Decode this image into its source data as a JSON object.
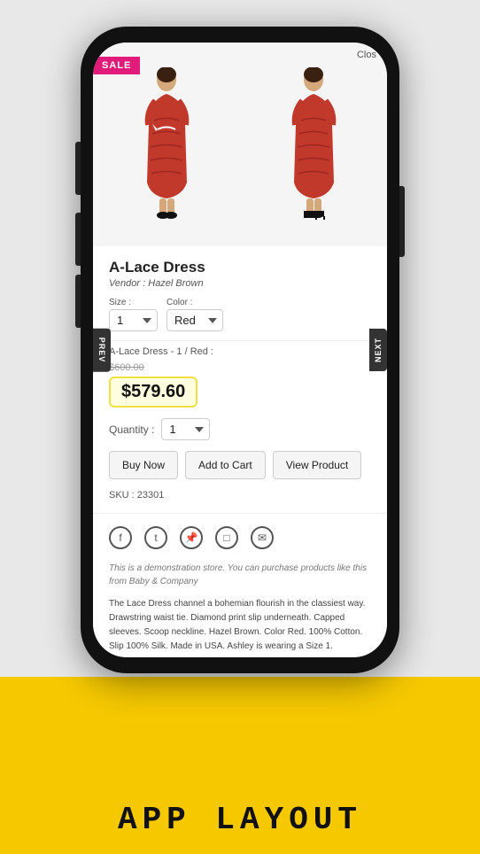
{
  "background": {
    "yellow_color": "#f5c800",
    "app_layout_label": "APP LAYOUT"
  },
  "phone": {
    "close_button": "Clos",
    "side_tabs": {
      "prev": "PREV",
      "next": "NEXT"
    },
    "sale_badge": "SALE",
    "product": {
      "title": "A-Lace Dress",
      "vendor_label": "Vendor :",
      "vendor_name": "Hazel Brown",
      "size_label": "Size :",
      "size_value": "1",
      "color_label": "Color :",
      "color_value": "Red",
      "variant_text": "A-Lace Dress - 1 / Red :",
      "price_old": "$600.00",
      "price_current": "$579.60",
      "quantity_label": "Quantity :",
      "quantity_value": "1",
      "buttons": {
        "buy_now": "Buy Now",
        "add_to_cart": "Add to Cart",
        "view_product": "View Product"
      },
      "sku_label": "SKU :",
      "sku_value": "23301"
    },
    "social_icons": [
      "f",
      "t",
      "p",
      "i",
      "m"
    ],
    "demo_text": "This is a demonstration store. You can purchase products like this from Baby & Company",
    "description": "The Lace Dress channel a bohemian flourish in the classiest way. Drawstring waist tie. Diamond print slip underneath. Capped sleeves. Scoop neckline. Hazel Brown. Color Red. 100% Cotton. Slip 100% Silk. Made in USA. Ashley is wearing a Size 1."
  }
}
